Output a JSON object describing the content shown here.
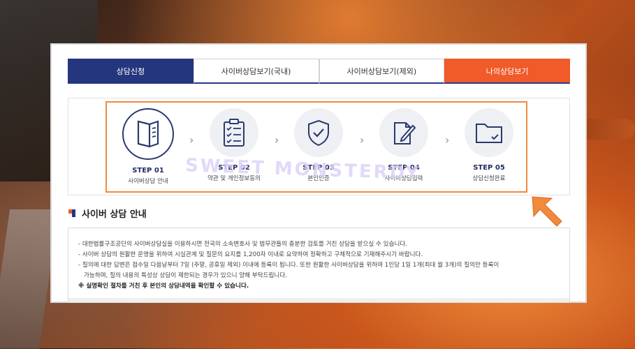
{
  "tabs": [
    {
      "label": "상담신청"
    },
    {
      "label": "사이버상담보기(국내)"
    },
    {
      "label": "사이버상담보기(제외)"
    },
    {
      "label": "나의상담보기"
    }
  ],
  "steps": [
    {
      "label": "STEP 01",
      "desc": "사이버상담 안내",
      "icon": "book-icon"
    },
    {
      "label": "STEP 02",
      "desc": "약관 및 개인정보동의",
      "icon": "checklist-icon"
    },
    {
      "label": "STEP 03",
      "desc": "본인인증",
      "icon": "shield-check-icon"
    },
    {
      "label": "STEP 04",
      "desc": "사이버상담입력",
      "icon": "document-edit-icon"
    },
    {
      "label": "STEP 05",
      "desc": "상담신청완료",
      "icon": "folder-check-icon"
    }
  ],
  "watermark": "SWEET MONSTERDY",
  "section": {
    "title": "사이버 상담 안내"
  },
  "info": {
    "lines": [
      "- 대한법률구조공단의 사이버상담실을 이용하시면 전국의 소속변호사 및 법무관들의 충분한 검토를 거친 상담을 받으실 수 있습니다.",
      "- 사이버 상담의 원활한 운영을 위하여 시실관계 및 질문의 요지를 1,200자 이내로 요약하여 정확하고 구체적으로 기재해주시기 바랍니다.",
      "- 질의에 대한 답변은 접수일 다음날부터 7일 (주말, 공휴일 제외) 이내에 등록이 됩니다. 또한 원활한 사이버상담을 위하여 1인당 1일 1개(최대 월 3개)의 질의만 등록이",
      "가능하며, 질의 내용의 특성상 상담이 제한되는 경우가 있으니 양해 부탁드립니다."
    ],
    "note": "※ 실명확인 절차를 거친 후 본인의 상담내역을 확인할 수 있습니다."
  },
  "colors": {
    "navy": "#24367e",
    "orange": "#f15a29",
    "highlight": "#ef8a3e"
  }
}
